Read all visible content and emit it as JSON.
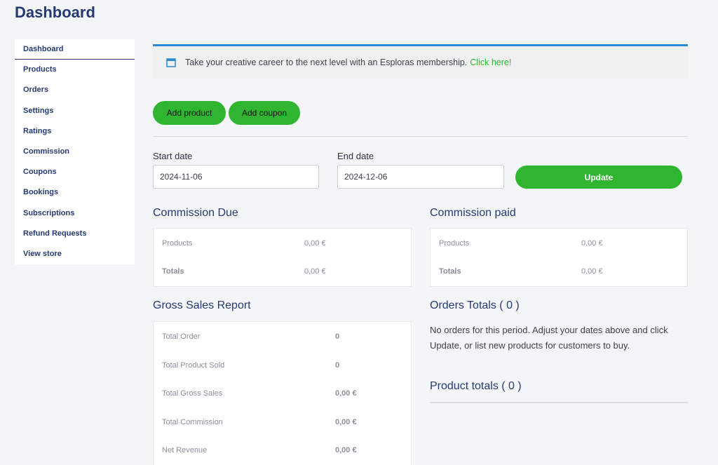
{
  "page_title": "Dashboard",
  "sidebar": {
    "items": [
      {
        "label": "Dashboard"
      },
      {
        "label": "Products"
      },
      {
        "label": "Orders"
      },
      {
        "label": "Settings"
      },
      {
        "label": "Ratings"
      },
      {
        "label": "Commission"
      },
      {
        "label": "Coupons"
      },
      {
        "label": "Bookings"
      },
      {
        "label": "Subscriptions"
      },
      {
        "label": "Refund Requests"
      },
      {
        "label": "View store"
      }
    ]
  },
  "notice": {
    "text": "Take your creative career to the next level with an Esploras membership.",
    "link": "Click here!"
  },
  "actions": {
    "add_product": "Add product",
    "add_coupon": "Add coupon"
  },
  "date_filter": {
    "start_label": "Start date",
    "start_value": "2024-11-06",
    "end_label": "End date",
    "end_value": "2024-12-06",
    "update_label": "Update"
  },
  "commission_due": {
    "title": "Commission Due",
    "products_label": "Products",
    "products_value": "0,00 €",
    "totals_label": "Totals",
    "totals_value": "0,00 €"
  },
  "commission_paid": {
    "title": "Commission paid",
    "products_label": "Products",
    "products_value": "0,00 €",
    "totals_label": "Totals",
    "totals_value": "0,00 €"
  },
  "gross_sales": {
    "title": "Gross Sales Report",
    "rows": [
      {
        "label": "Total Order",
        "value": "0"
      },
      {
        "label": "Total Product Sold",
        "value": "0"
      },
      {
        "label": "Total Gross Sales",
        "value": "0,00 €"
      },
      {
        "label": "Total Commission",
        "value": "0,00 €"
      },
      {
        "label": "Net Revenue",
        "value": "0,00 €"
      }
    ]
  },
  "orders_totals": {
    "title": "Orders Totals ( 0 )",
    "message": "No orders for this period. Adjust your dates above and click Update, or list new products for customers to buy."
  },
  "product_totals": {
    "title": "Product totals ( 0 )"
  },
  "colors": {
    "brand_navy": "#253a75",
    "accent_green": "#2fb52f",
    "notice_border": "#2b8ad0"
  }
}
